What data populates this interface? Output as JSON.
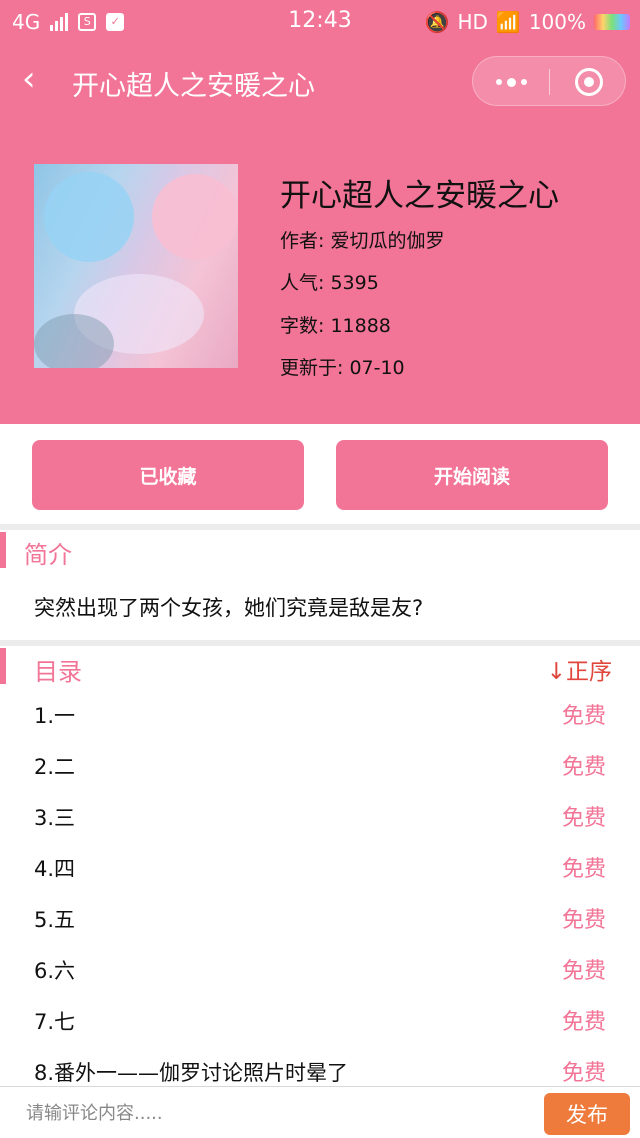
{
  "status_bar": {
    "network": "4G",
    "time": "12:43",
    "hd": "HD",
    "battery": "100%"
  },
  "nav": {
    "title": "开心超人之安暖之心"
  },
  "book": {
    "title": "开心超人之安暖之心",
    "author": "作者: 爱切瓜的伽罗",
    "popularity": "人气: 5395",
    "word_count": "字数: 11888",
    "updated": "更新于: 07-10"
  },
  "actions": {
    "collect_label": "已收藏",
    "read_label": "开始阅读"
  },
  "intro": {
    "heading": "简介",
    "text": "突然出现了两个女孩，她们究竟是敌是友?"
  },
  "catalog": {
    "heading": "目录",
    "sort_label": "↓正序",
    "chapters": [
      {
        "title": "1.一",
        "price": "免费"
      },
      {
        "title": "2.二",
        "price": "免费"
      },
      {
        "title": "3.三",
        "price": "免费"
      },
      {
        "title": "4.四",
        "price": "免费"
      },
      {
        "title": "5.五",
        "price": "免费"
      },
      {
        "title": "6.六",
        "price": "免费"
      },
      {
        "title": "7.七",
        "price": "免费"
      },
      {
        "title": "8.番外一——伽罗讨论照片时晕了",
        "price": "免费"
      }
    ]
  },
  "comment": {
    "placeholder": "请输评论内容.....",
    "send_label": "发布"
  },
  "colors": {
    "accent": "#f27496",
    "send_button": "#ee7a3c",
    "sort_text": "#e0463c"
  }
}
